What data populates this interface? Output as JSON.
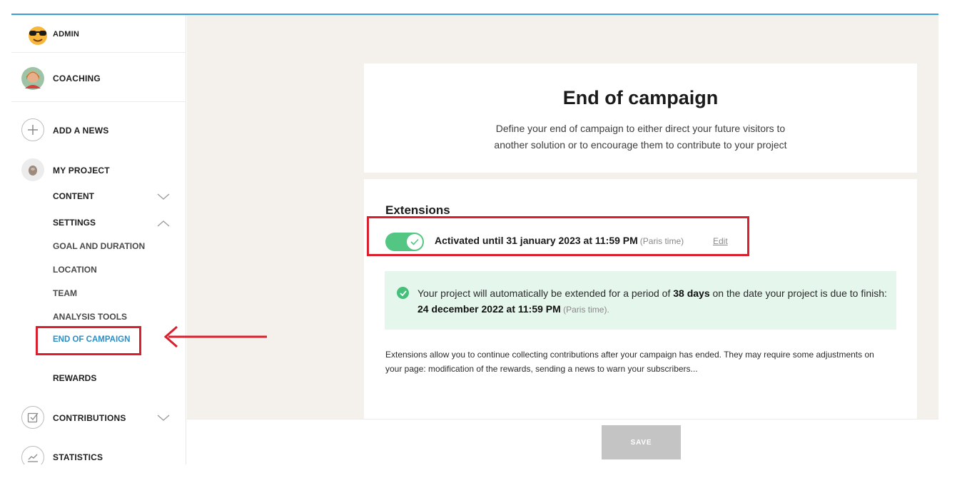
{
  "sidebar": {
    "admin_label": "ADMIN",
    "coaching_label": "COACHING",
    "add_news_label": "ADD A NEWS",
    "my_project_label": "MY PROJECT",
    "content_label": "CONTENT",
    "settings_label": "SETTINGS",
    "sub_items": [
      "GOAL AND DURATION",
      "LOCATION",
      "TEAM",
      "ANALYSIS TOOLS",
      "END OF CAMPAIGN"
    ],
    "rewards_label": "REWARDS",
    "contributions_label": "CONTRIBUTIONS",
    "statistics_label": "STATISTICS"
  },
  "main": {
    "title": "End of campaign",
    "intro_line1": "Define your end of campaign to either direct your future visitors to",
    "intro_line2": "another solution or to encourage them to contribute to your project",
    "extensions_title": "Extensions",
    "activated_text": "Activated until 31 january 2023 at 11:59 PM",
    "activated_tz": "(Paris time)",
    "edit_label": "Edit",
    "notice_pre": "Your project will automatically be extended for a period of ",
    "notice_days": "38 days",
    "notice_mid": " on the date your project is due to finish: ",
    "notice_date": "24 december 2022 at 11:59 PM",
    "notice_tz": " (Paris time).",
    "description": "Extensions allow you to continue collecting contributions after your campaign has ended. They may require some adjustments on your page: modification of the rewards, sending a news to warn your subscribers..."
  },
  "footer": {
    "save_label": "SAVE"
  },
  "colors": {
    "accent": "#2a8fc7",
    "toggle_on": "#54c684",
    "highlight": "#d8202e",
    "save_disabled": "#c4c4c4"
  },
  "icons": [
    "sunglasses-emoji-icon",
    "coaching-avatar",
    "plus-icon",
    "project-avatar",
    "chevron-down-icon",
    "chevron-up-icon",
    "check-icon",
    "checkbox-icon",
    "chart-icon",
    "arrow-left-icon"
  ]
}
